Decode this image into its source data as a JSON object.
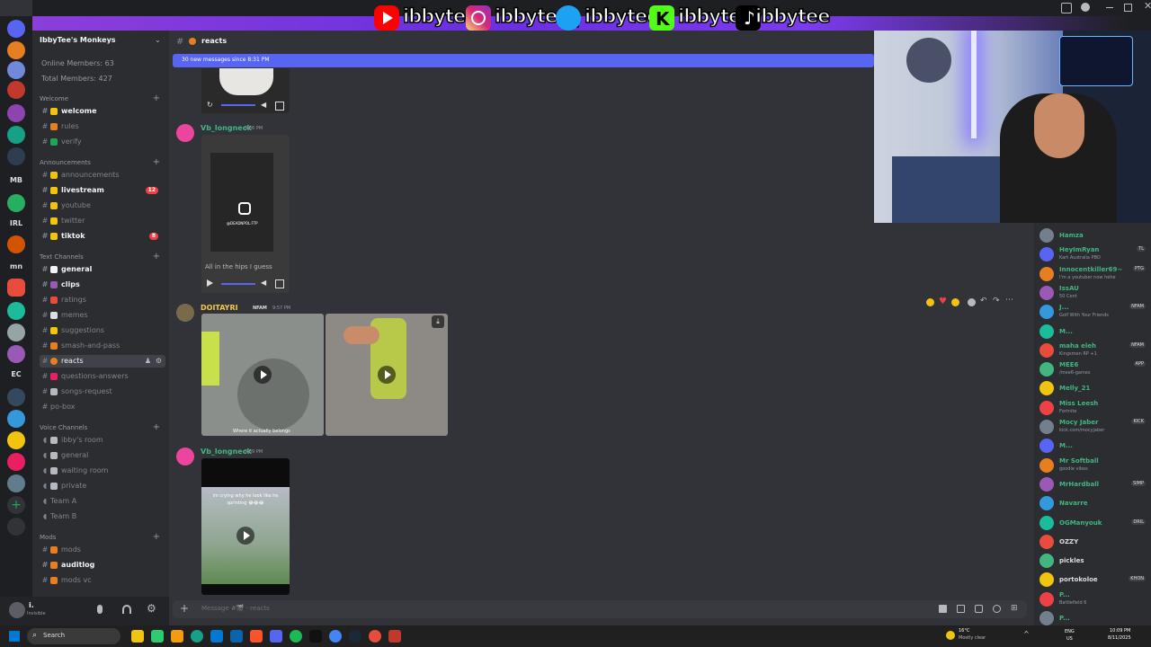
{
  "overlay": {
    "handles": [
      "ibbytee",
      "ibbytee_",
      "ibbytee_",
      "ibbytee",
      "ibbytee"
    ],
    "colors": {
      "youtube": "#ff0000",
      "instagram": "#d62976",
      "twitter": "#1da1f2",
      "kick": "#53fc18",
      "tiktok": "#000000"
    }
  },
  "server": {
    "name": "IbbyTee's Monkeys",
    "stats": [
      "Online Members: 63",
      "Total Members: 427"
    ]
  },
  "rail": {
    "labels": [
      "MB",
      "IRL",
      "mn",
      "EC"
    ]
  },
  "categories": {
    "welcome": "Welcome",
    "announcements": "Announcements",
    "text": "Text Channels",
    "voice": "Voice Channels",
    "mods": "Mods"
  },
  "channels": {
    "welcome": [
      {
        "name": "welcome"
      },
      {
        "name": "rules"
      },
      {
        "name": "verify"
      }
    ],
    "announcements": [
      {
        "name": "announcements"
      },
      {
        "name": "livestream",
        "badge": "12"
      },
      {
        "name": "youtube"
      },
      {
        "name": "twitter"
      },
      {
        "name": "tiktok",
        "badge": "8"
      }
    ],
    "text": [
      {
        "name": "general"
      },
      {
        "name": "clips"
      },
      {
        "name": "ratings"
      },
      {
        "name": "memes"
      },
      {
        "name": "suggestions"
      },
      {
        "name": "smash-and-pass"
      },
      {
        "name": "reacts"
      },
      {
        "name": "questions-answers"
      },
      {
        "name": "songs-request"
      },
      {
        "name": "po-box"
      }
    ],
    "voice": [
      {
        "name": "ibby's room"
      },
      {
        "name": "general"
      },
      {
        "name": "waiting room"
      },
      {
        "name": "private"
      },
      {
        "name": "Team A"
      },
      {
        "name": "Team B"
      }
    ],
    "mods": [
      {
        "name": "mods"
      },
      {
        "name": "auditlog"
      },
      {
        "name": "mods vc"
      }
    ]
  },
  "user": {
    "name": "i.",
    "status": "Invisible"
  },
  "header": {
    "channel": "reacts"
  },
  "newbar": {
    "text": "30 new messages since 8:31 PM"
  },
  "messages": [
    {
      "author": "Vb_longneck",
      "time": "9:56 PM",
      "video_caption": "All in the hips I guess",
      "video_handle": "@DEADNPOL.FTP"
    },
    {
      "author": "DOITAYRI",
      "time": "9:57 PM",
      "tag": "NFAM",
      "video_caption": "Where it actually belongs"
    },
    {
      "author": "Vb_longneck",
      "time": "9:59 PM",
      "video_caption": "im crying why he look like he sprinting 😂😂😂"
    }
  ],
  "composer": {
    "placeholder": "Message #🎬 · reacts"
  },
  "members": [
    {
      "name": "Hamza",
      "status": "",
      "color": "#43b581"
    },
    {
      "name": "HeyImRyan",
      "status": "Kart Australia PBO",
      "color": "#43b581",
      "tag": "TL"
    },
    {
      "name": "Innocentkiller69~",
      "status": "I'm a youtuber now hehe",
      "color": "#43b581",
      "tag": "PTG"
    },
    {
      "name": "IssAU",
      "status": "50 Cent",
      "color": "#43b581"
    },
    {
      "name": "J...",
      "status": "Golf With Your Friends",
      "color": "#43b581",
      "tag": "NFAM"
    },
    {
      "name": "M...",
      "status": "",
      "color": "#43b581"
    },
    {
      "name": "maha eleh",
      "status": "Kingsmen RP +1",
      "color": "#43b581",
      "tag": "NFAM"
    },
    {
      "name": "MEE6",
      "status": "/mee6-games",
      "color": "#43b581",
      "tag": "APP"
    },
    {
      "name": "Melly_21",
      "status": "",
      "color": "#43b581"
    },
    {
      "name": "Miss Leesh",
      "status": "Fortnite",
      "color": "#43b581"
    },
    {
      "name": "Mocy Jaber",
      "status": "kick.com/mocyjaber",
      "color": "#43b581",
      "tag": "KICK"
    },
    {
      "name": "M...",
      "status": "",
      "color": "#43b581"
    },
    {
      "name": "Mr Softball",
      "status": "goodie vibes",
      "color": "#43b581"
    },
    {
      "name": "MrHardball",
      "status": "",
      "color": "#43b581",
      "tag": "SIMP"
    },
    {
      "name": "Navarre",
      "status": "",
      "color": "#43b581"
    },
    {
      "name": "OGManyouk",
      "status": "",
      "color": "#43b581",
      "tag": "DRIL"
    },
    {
      "name": "OZZY",
      "status": "",
      "color": "#dbdee1"
    },
    {
      "name": "pickles",
      "status": "",
      "color": "#dbdee1"
    },
    {
      "name": "portokoloe",
      "status": "",
      "color": "#dbdee1",
      "tag": "KHON"
    },
    {
      "name": "P...",
      "status": "Battlefield 6",
      "color": "#43b581"
    },
    {
      "name": "P...",
      "status": "",
      "color": "#43b581"
    }
  ],
  "taskbar": {
    "search": "Search",
    "weather": "16°C",
    "weather_sub": "Mostly clear",
    "lang": "ENG",
    "lang_sub": "US",
    "time": "10:09 PM",
    "date": "8/11/2025"
  }
}
